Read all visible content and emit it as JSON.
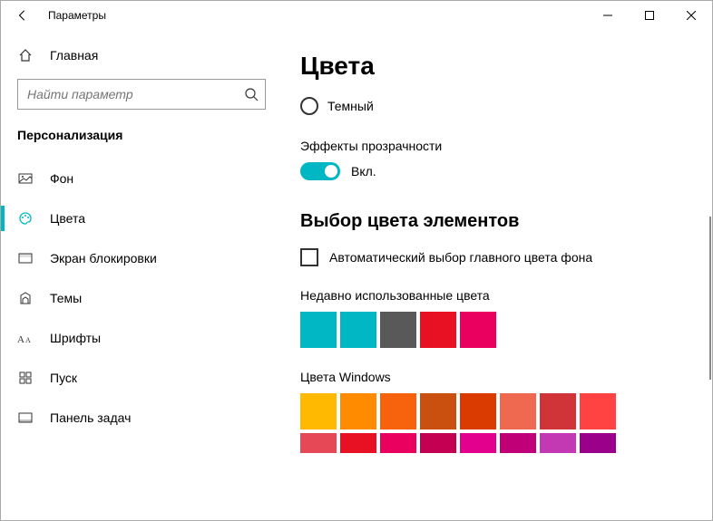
{
  "window": {
    "title": "Параметры"
  },
  "sidebar": {
    "home": "Главная",
    "search_placeholder": "Найти параметр",
    "section": "Персонализация",
    "items": [
      {
        "label": "Фон"
      },
      {
        "label": "Цвета"
      },
      {
        "label": "Экран блокировки"
      },
      {
        "label": "Темы"
      },
      {
        "label": "Шрифты"
      },
      {
        "label": "Пуск"
      },
      {
        "label": "Панель задач"
      }
    ]
  },
  "content": {
    "heading": "Цвета",
    "dark_option": "Темный",
    "transparency_label": "Эффекты прозрачности",
    "toggle_state": "Вкл.",
    "accent_heading": "Выбор цвета элементов",
    "auto_pick_label": "Автоматический выбор главного цвета фона",
    "recent_label": "Недавно использованные цвета",
    "recent_colors": [
      "#00b7c3",
      "#00b7c3",
      "#595959",
      "#e81123",
      "#ea005e"
    ],
    "windows_label": "Цвета Windows",
    "windows_colors_row1": [
      "#ffb900",
      "#ff8c00",
      "#f7630c",
      "#ca5010",
      "#da3b01",
      "#ef6950",
      "#d13438",
      "#ff4343"
    ],
    "windows_colors_row2": [
      "#e74856",
      "#e81123",
      "#ea005e",
      "#c30052",
      "#e3008c",
      "#bf0077",
      "#c239b3",
      "#9a0089"
    ]
  }
}
